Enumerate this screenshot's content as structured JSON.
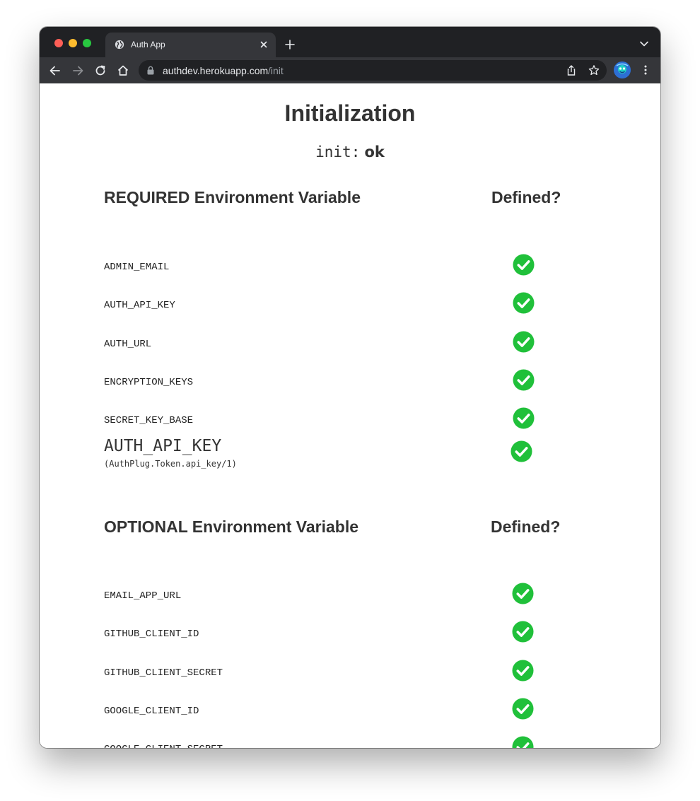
{
  "browser": {
    "tab_title": "Auth App",
    "url_host": "authdev.herokuapp.com",
    "url_path": "/init"
  },
  "page": {
    "title": "Initialization",
    "init_key": "init:",
    "init_value": "ok"
  },
  "required": {
    "heading_prefix": "REQUIRED",
    "heading_suffix": " Environment Variable",
    "defined_label": "Defined?",
    "items": [
      {
        "name": "ADMIN_EMAIL",
        "defined": true
      },
      {
        "name": "AUTH_API_KEY",
        "defined": true
      },
      {
        "name": "AUTH_URL",
        "defined": true
      },
      {
        "name": "ENCRYPTION_KEYS",
        "defined": true
      },
      {
        "name": "SECRET_KEY_BASE",
        "defined": true
      }
    ]
  },
  "api_key_check": {
    "name": "AUTH_API_KEY",
    "function": "(AuthPlug.Token.api_key/1)",
    "defined": true
  },
  "optional": {
    "heading_prefix": "OPTIONAL",
    "heading_suffix": " Environment Variable",
    "defined_label": "Defined?",
    "items": [
      {
        "name": "EMAIL_APP_URL",
        "defined": true
      },
      {
        "name": "GITHUB_CLIENT_ID",
        "defined": true
      },
      {
        "name": "GITHUB_CLIENT_SECRET",
        "defined": true
      },
      {
        "name": "GOOGLE_CLIENT_ID",
        "defined": true
      },
      {
        "name": "GOOGLE_CLIENT_SECRET",
        "defined": true
      }
    ]
  },
  "colors": {
    "check": "#20c03a",
    "browser_dark": "#202124",
    "browser_mid": "#35363a",
    "text": "#333333"
  }
}
